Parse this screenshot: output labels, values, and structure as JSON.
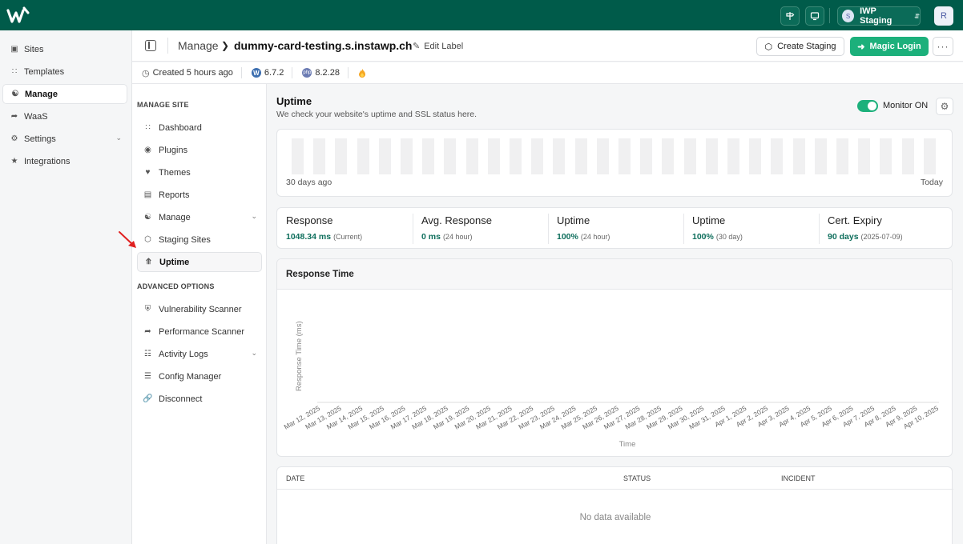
{
  "topbar": {
    "team_name": "IWP Staging",
    "team_initial": "S",
    "user_initial": "R"
  },
  "nav": {
    "items": [
      {
        "label": "Sites",
        "icon": "layout-icon"
      },
      {
        "label": "Templates",
        "icon": "grid-icon"
      },
      {
        "label": "Manage",
        "icon": "sitemap-icon"
      },
      {
        "label": "WaaS",
        "icon": "rocket-icon"
      },
      {
        "label": "Settings",
        "icon": "gear-icon"
      },
      {
        "label": "Integrations",
        "icon": "puzzle-icon"
      }
    ]
  },
  "header": {
    "crumb": "Manage",
    "site": "dummy-card-testing.s.instawp.ch",
    "edit_label": "Edit Label",
    "create_staging": "Create Staging",
    "magic_login": "Magic Login"
  },
  "subheader": {
    "created": "Created 5 hours ago",
    "wp_version": "6.7.2",
    "php_version": "8.2.28"
  },
  "submenu": {
    "section1": "MANAGE SITE",
    "items1": [
      "Dashboard",
      "Plugins",
      "Themes",
      "Reports",
      "Manage",
      "Staging Sites",
      "Uptime"
    ],
    "section2": "ADVANCED OPTIONS",
    "items2": [
      "Vulnerability Scanner",
      "Performance Scanner",
      "Activity Logs",
      "Config Manager",
      "Disconnect"
    ]
  },
  "uptime": {
    "title": "Uptime",
    "subtitle": "We check your website's uptime and SSL status here.",
    "monitor_label": "Monitor ON",
    "monitor_on": true,
    "range_start": "30 days ago",
    "range_end": "Today",
    "bar_count": 30,
    "bar_color": "#f0f0f1"
  },
  "stats": [
    {
      "label": "Response",
      "value": "1048.34 ms",
      "note": "(Current)"
    },
    {
      "label": "Avg. Response",
      "value": "0 ms",
      "note": "(24 hour)"
    },
    {
      "label": "Uptime",
      "value": "100%",
      "note": "(24 hour)"
    },
    {
      "label": "Uptime",
      "value": "100%",
      "note": "(30 day)"
    },
    {
      "label": "Cert. Expiry",
      "value": "90 days",
      "note": "(2025-07-09)"
    }
  ],
  "chart_data": {
    "type": "line",
    "title": "Response Time",
    "xlabel": "Time",
    "ylabel": "Response Time (ms)",
    "categories": [
      "Mar 12, 2025",
      "Mar 13, 2025",
      "Mar 14, 2025",
      "Mar 15, 2025",
      "Mar 16, 2025",
      "Mar 17, 2025",
      "Mar 18, 2025",
      "Mar 19, 2025",
      "Mar 20, 2025",
      "Mar 21, 2025",
      "Mar 22, 2025",
      "Mar 23, 2025",
      "Mar 24, 2025",
      "Mar 25, 2025",
      "Mar 26, 2025",
      "Mar 27, 2025",
      "Mar 28, 2025",
      "Mar 29, 2025",
      "Mar 30, 2025",
      "Mar 31, 2025",
      "Apr 1, 2025",
      "Apr 2, 2025",
      "Apr 3, 2025",
      "Apr 4, 2025",
      "Apr 5, 2025",
      "Apr 6, 2025",
      "Apr 7, 2025",
      "Apr 8, 2025",
      "Apr 9, 2025",
      "Apr 10, 2025"
    ],
    "series": []
  },
  "table": {
    "columns": [
      "DATE",
      "STATUS",
      "INCIDENT"
    ],
    "empty_text": "No data available"
  }
}
